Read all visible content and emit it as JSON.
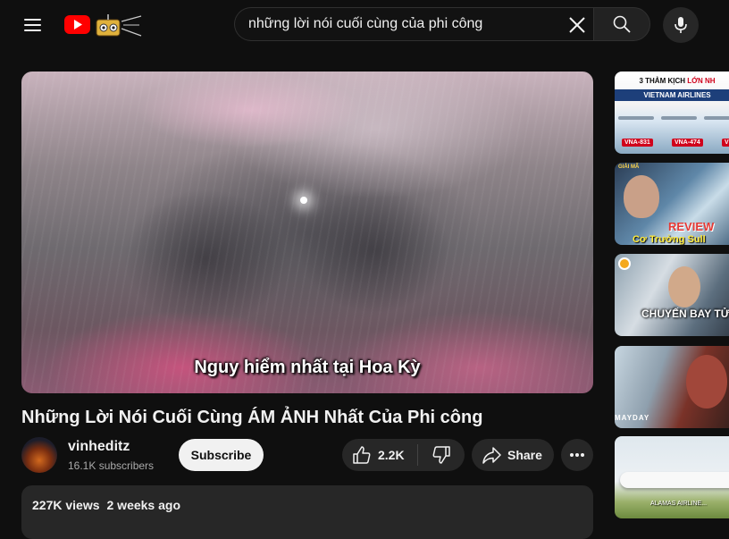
{
  "search": {
    "query": "những lời nói cuối cùng của phi công"
  },
  "video": {
    "caption": "Nguy hiểm nhất tại Hoa Kỳ",
    "title": "Những Lời Nói Cuối Cùng ÁM ẢNH Nhất Của Phi công"
  },
  "channel": {
    "name": "vinheditz",
    "subscribers": "16.1K subscribers",
    "subscribe_label": "Subscribe"
  },
  "actions": {
    "like_count": "2.2K",
    "share_label": "Share"
  },
  "description": {
    "views": "227K views",
    "age": "2 weeks ago"
  },
  "sidebar": {
    "items": [
      {
        "heading_prefix": "3 THẢM KỊCH ",
        "heading_highlight": "LỚN NH",
        "subheading": "VIETNAM AIRLINES",
        "tags": [
          "VNA-831",
          "VNA-474",
          "V"
        ]
      },
      {
        "badge": "GIẢI MÃ",
        "review": "REVIEW",
        "caption": "Cơ Trưởng Sull"
      },
      {
        "caption": "CHUYẾN BAY TỬ T"
      },
      {
        "caption": "MAYDAY"
      },
      {
        "caption": "ALAMAS AIRLINE..."
      }
    ]
  },
  "colors": {
    "background": "#0f0f0f",
    "youtube_red": "#ff0000",
    "button_dark": "#272727",
    "text_primary": "#f1f1f1",
    "text_secondary": "#aaaaaa"
  }
}
